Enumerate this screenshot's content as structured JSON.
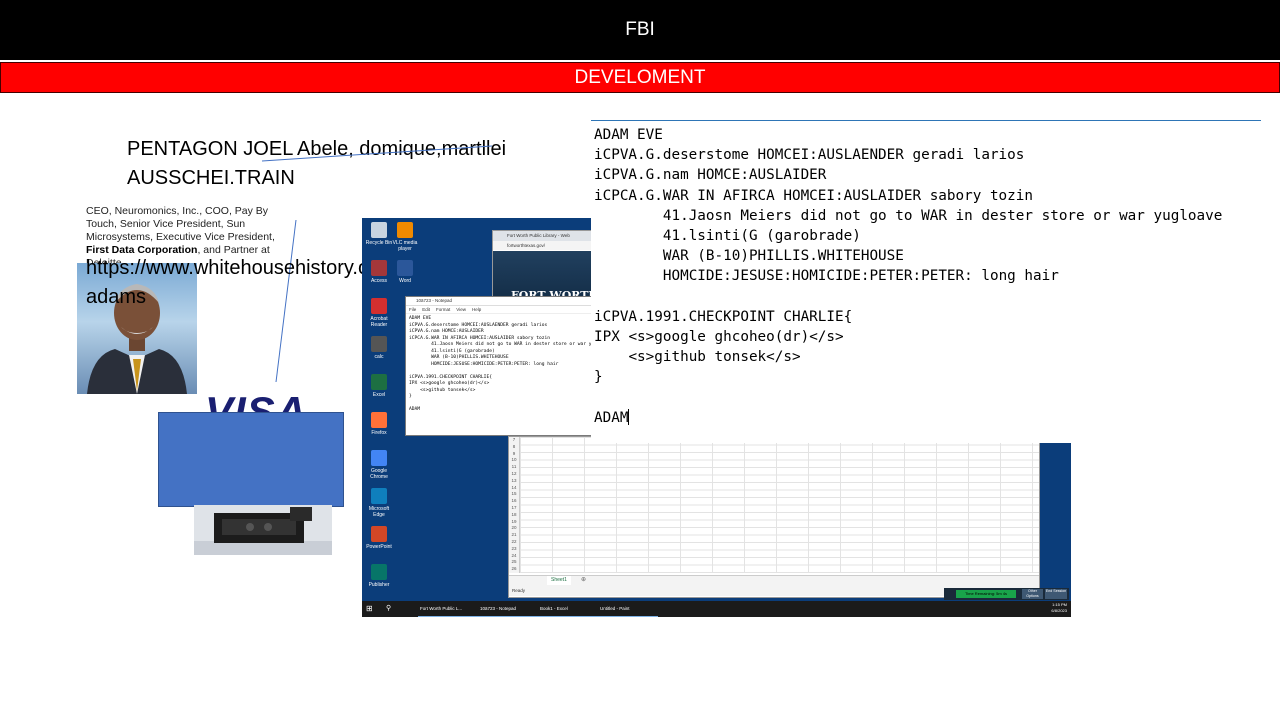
{
  "slide": {
    "title": "FBI",
    "subtitle": "DEVELOMENT",
    "heading_line1": "PENTAGON JOEL Abele, domique,martllei",
    "heading_line2": "AUSSCHEI.TRAIN",
    "bio_pre": "CEO,  Neuromonics, Inc., COO,  Pay By Touch, Senior Vice President, Sun Microsystems, Executive Vice President, ",
    "bio_bold": "First Data Corporation",
    "bio_post": ", and Partner at Deloitte",
    "url_line1": "https://www.whitehousehistory.org/national-council",
    "url_line2": "adams",
    "visa_logo": "VISA"
  },
  "desktop": {
    "icons": [
      {
        "name": "recycle-bin-icon",
        "label": "Recycle Bin",
        "color": "#c8d4e0"
      },
      {
        "name": "access-icon",
        "label": "Access",
        "color": "#a4373a"
      },
      {
        "name": "acrobat-reader-icon",
        "label": "Acrobat Reader",
        "color": "#d32f2f"
      },
      {
        "name": "calc-icon",
        "label": "calc",
        "color": "#555555"
      },
      {
        "name": "excel-icon",
        "label": "Excel",
        "color": "#1d6f42"
      },
      {
        "name": "firefox-icon",
        "label": "Firefox",
        "color": "#ff7139"
      },
      {
        "name": "chrome-icon",
        "label": "Google Chrome",
        "color": "#4285f4"
      },
      {
        "name": "edge-icon",
        "label": "Microsoft Edge",
        "color": "#0f7fbd"
      },
      {
        "name": "powerpoint-icon",
        "label": "PowerPoint",
        "color": "#d24726"
      },
      {
        "name": "publisher-icon",
        "label": "Publisher",
        "color": "#077568"
      }
    ],
    "icons_col2": [
      {
        "name": "vlc-icon",
        "label": "VLC media player",
        "color": "#f08a00"
      },
      {
        "name": "word-icon",
        "label": "Word",
        "color": "#2b579a"
      }
    ],
    "browser_tab": "Fort Worth Public Library - Web",
    "browser_address": "fortworthtexas.gov/",
    "browser_banner": "FORT WORTH.",
    "notepad_title": "10ä723 - Notepad",
    "notepad_menu": [
      "File",
      "Edit",
      "Format",
      "View",
      "Help"
    ],
    "excel_sheet_tab": "Sheet1",
    "excel_status": "Ready",
    "excel_zoom": "100%",
    "excel_rows": [
      "7",
      "8",
      "9",
      "10",
      "11",
      "12",
      "13",
      "14",
      "15",
      "16",
      "17",
      "18",
      "19",
      "20",
      "21",
      "22",
      "23",
      "24",
      "25",
      "26"
    ],
    "taskbar_items": [
      "Fort Worth Public L...",
      "10ä723 - Notepad",
      "Book1 - Excel",
      "Untitled - Paint"
    ],
    "time_remaining": "Time Remaining: 5m 4s",
    "other_options": "Other Options",
    "end_session": "End Session",
    "clock_time": "1:15 PM",
    "clock_date": "6/8/2023"
  },
  "code": {
    "l1": "ADAM EVE",
    "l2": "iCPVA.G.deserstome HOMCEI:AUSLAENDER geradi larios",
    "l3": "iCPVA.G.nam HOMCE:AUSLAIDER",
    "l4": "iCPCA.G.WAR IN AFIRCA HOMCEI:AUSLAIDER sabory tozin",
    "l5": "41.Jaosn Meiers did not go to WAR in dester store or war yugloave",
    "l6": "41.lsinti(G (garobrade)",
    "l7": "WAR (B-10)PHILLIS.WHITEHOUSE",
    "l8": "HOMCIDE:JESUSE:HOMICIDE:PETER:PETER: long hair",
    "l9": "iCPVA.1991.CHECKPOINT CHARLIE{",
    "l10_pre": "IPX ",
    "l10_strike": "<s>google ghcoheo(dr)</s>",
    "l11_strike": "<s>github tonsek</s>",
    "l12": "}",
    "l13": "ADAM"
  }
}
